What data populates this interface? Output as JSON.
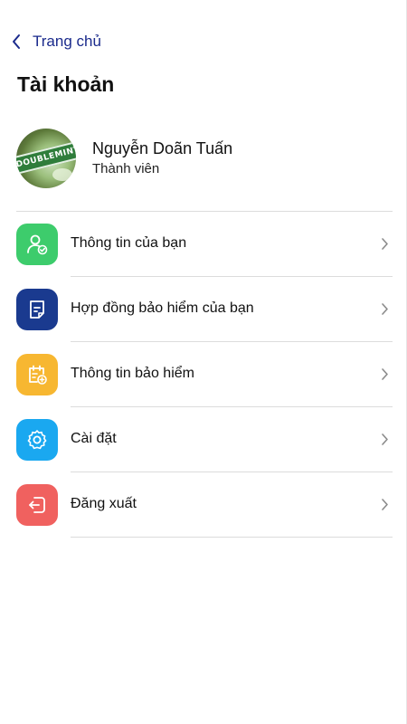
{
  "nav": {
    "back_label": "Trang chủ",
    "back_icon": "chevron-left-icon"
  },
  "page": {
    "title": "Tài khoản"
  },
  "profile": {
    "name": "Nguyễn Doãn Tuấn",
    "role": "Thành viên",
    "avatar_text": "DOUBLEMINT"
  },
  "menu": {
    "items": [
      {
        "label": "Thông tin của bạn",
        "icon": "user-check-icon",
        "color": "#3dcc6c"
      },
      {
        "label": "Hợp đồng bảo hiểm của bạn",
        "icon": "document-icon",
        "color": "#1a3a8f"
      },
      {
        "label": "Thông tin bảo hiểm",
        "icon": "calendar-add-icon",
        "color": "#f7b731"
      },
      {
        "label": "Cài đặt",
        "icon": "gear-icon",
        "color": "#1aa8f0"
      },
      {
        "label": "Đăng xuất",
        "icon": "logout-icon",
        "color": "#f0615f"
      }
    ]
  },
  "colors": {
    "accent": "#1a2a8c",
    "divider": "#dcdcdc"
  }
}
